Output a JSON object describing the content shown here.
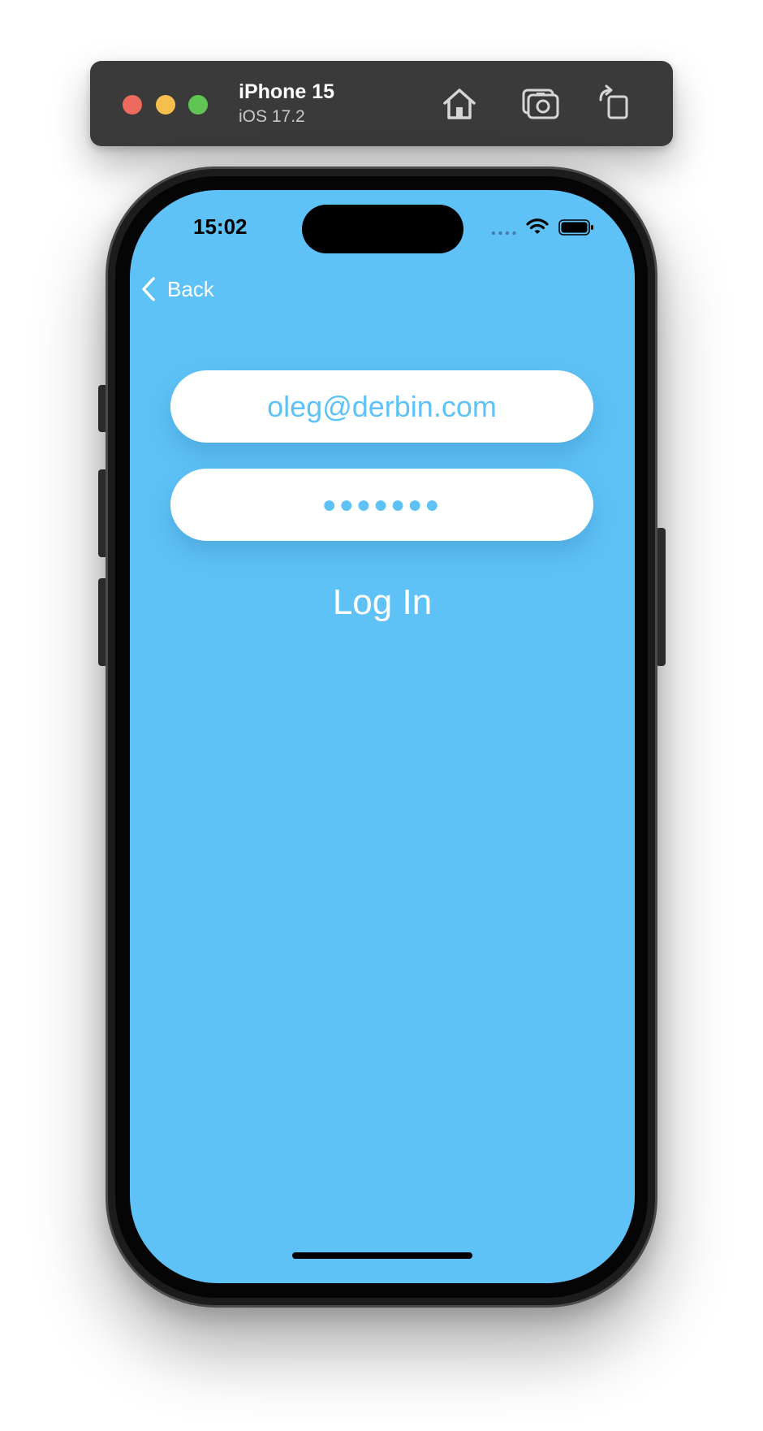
{
  "simulator": {
    "device_name": "iPhone 15",
    "os_version": "iOS 17.2",
    "icons": [
      "home-icon",
      "screenshot-icon",
      "rotate-icon"
    ],
    "traffic_colors": {
      "close": "#ed6a5e",
      "minimize": "#f5bf4f",
      "zoom": "#61c554"
    }
  },
  "status_bar": {
    "time": "15:02"
  },
  "nav": {
    "back_label": "Back"
  },
  "form": {
    "email_value": "oleg@derbin.com",
    "password_mask": "●●●●●●●",
    "login_label": "Log In"
  },
  "colors": {
    "screen_background": "#5ec2f7",
    "field_text": "#5ec2f7",
    "field_background": "#ffffff"
  }
}
